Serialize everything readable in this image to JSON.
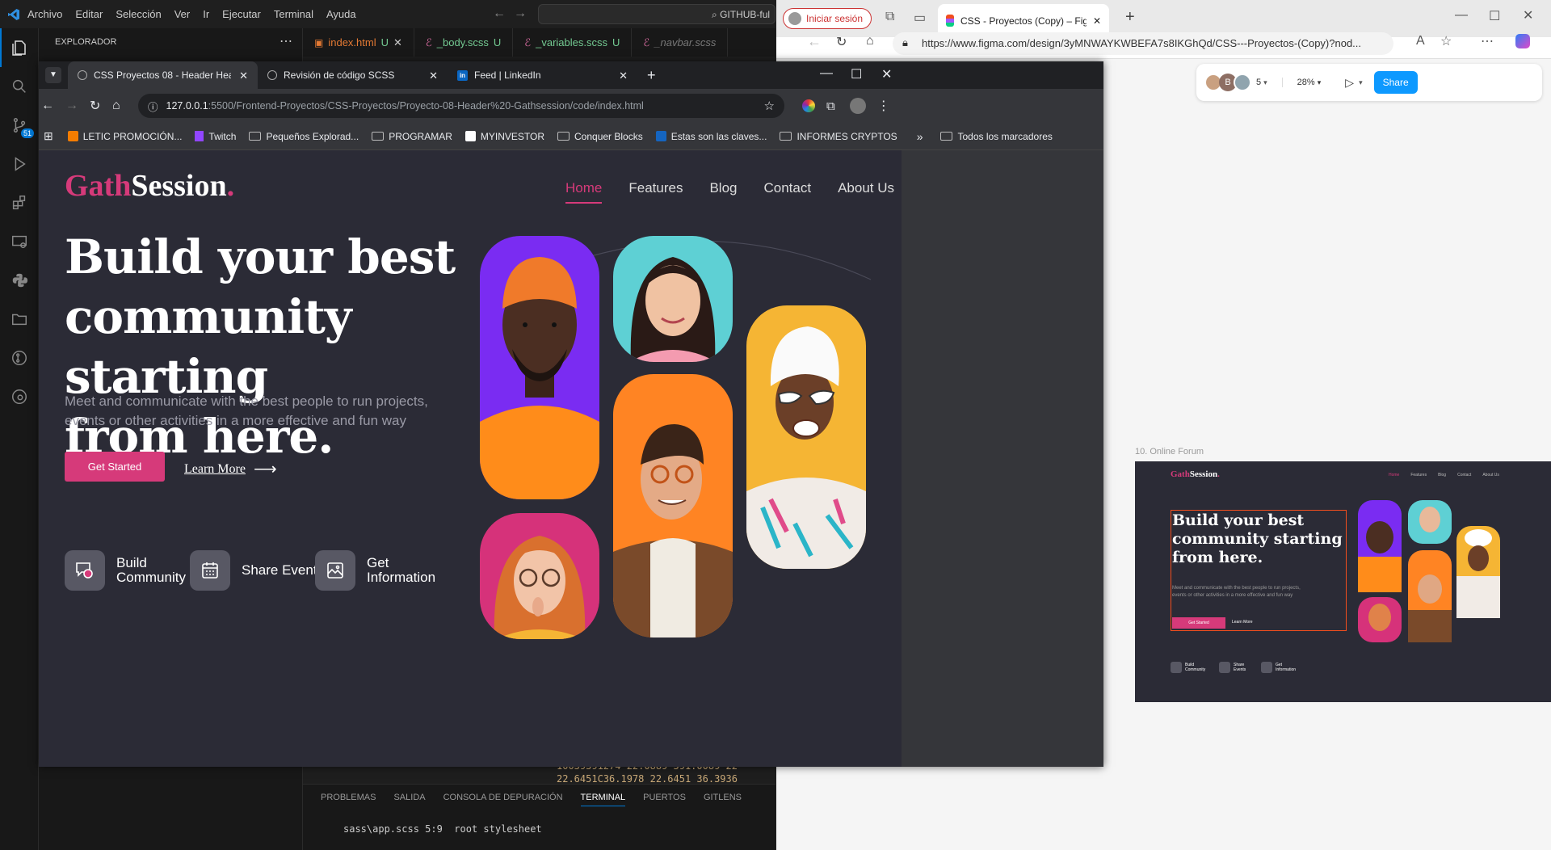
{
  "vscode": {
    "menu": [
      "Archivo",
      "Editar",
      "Selección",
      "Ver",
      "Ir",
      "Ejecutar",
      "Terminal",
      "Ayuda"
    ],
    "search_text": "GITHUB-ful",
    "explorer_title": "EXPLORADOR",
    "scm_badge": "51",
    "tabs": [
      {
        "label": "index.html",
        "status": "U",
        "color": "#e37933"
      },
      {
        "label": "_body.scss",
        "status": "U",
        "color": "#cd6799"
      },
      {
        "label": "_variables.scss",
        "status": "U",
        "color": "#cd6799"
      },
      {
        "label": "_navbar.scss",
        "status": "",
        "color": "#cd6799"
      }
    ],
    "panel_tabs": [
      "PROBLEMAS",
      "SALIDA",
      "CONSOLA DE DEPURACIÓN",
      "TERMINAL",
      "PUERTOS",
      "GITLENS"
    ],
    "active_panel_tab": "TERMINAL",
    "terminal_line": "sass\\app.scss 5:9  root stylesheet",
    "terminal_bg_text_1": "10039391274 22.0889 591.0089 22",
    "terminal_bg_text_2": "22.6451C36.1978 22.6451 36.3936"
  },
  "edge": {
    "signin": "Iniciar sesión",
    "tab_title": "CSS - Proyectos (Copy) – Figma",
    "url": "https://www.figma.com/design/3yMNWAYKWBEFA7s8IKGhQd/CSS---Proyectos-(Copy)?nod..."
  },
  "figma": {
    "avatar_count": "5",
    "avatar_b": "B",
    "zoom": "28%",
    "share_label": "Share",
    "frame_label": "10. Online Forum",
    "mini_title": "Build your best community starting from here.",
    "mini_desc": "Meet and communicate with the best people to run projects, events or other activities in a more effective and fun way",
    "mini_btn": "Get Started",
    "mini_link": "Learn More",
    "mini_features": [
      "Build Community",
      "Share Events",
      "Get Information"
    ],
    "mini_nav": [
      "Home",
      "Features",
      "Blog",
      "Contact",
      "About Us"
    ]
  },
  "chrome": {
    "tabs": [
      {
        "label": "CSS Proyectos 08 - Header Hea"
      },
      {
        "label": "Revisión de código SCSS"
      },
      {
        "label": "Feed | LinkedIn"
      }
    ],
    "url_host": "127.0.0.1",
    "url_rest": ":5500/Frontend-Proyectos/CSS-Proyectos/Proyecto-08-Header%20-Gathsession/code/index.html",
    "bookmarks": [
      "LETIC PROMOCIÓN...",
      "Twitch",
      "Pequeños Explorad...",
      "PROGRAMAR",
      "MYINVESTOR",
      "Conquer Blocks",
      "Estas son las claves...",
      "INFORMES CRYPTOS"
    ],
    "all_bookmarks": "Todos los marcadores"
  },
  "site": {
    "logo_a": "Gath",
    "logo_b": "Session",
    "logo_dot": ".",
    "nav": [
      "Home",
      "Features",
      "Blog",
      "Contact",
      "About Us"
    ],
    "title_lines": [
      "Build your best",
      "community starting",
      "from here."
    ],
    "description": "Meet and communicate with the best people to run projects, events or other activities in a more effective and fun way",
    "cta_primary": "Get Started",
    "cta_secondary": "Learn More",
    "features": [
      {
        "line1": "Build",
        "line2": "Community"
      },
      {
        "line1": "Share Events",
        "line2": ""
      },
      {
        "line1": "Get",
        "line2": "Information"
      }
    ],
    "accent": "#d63a7a",
    "bg": "#2b2b36"
  }
}
